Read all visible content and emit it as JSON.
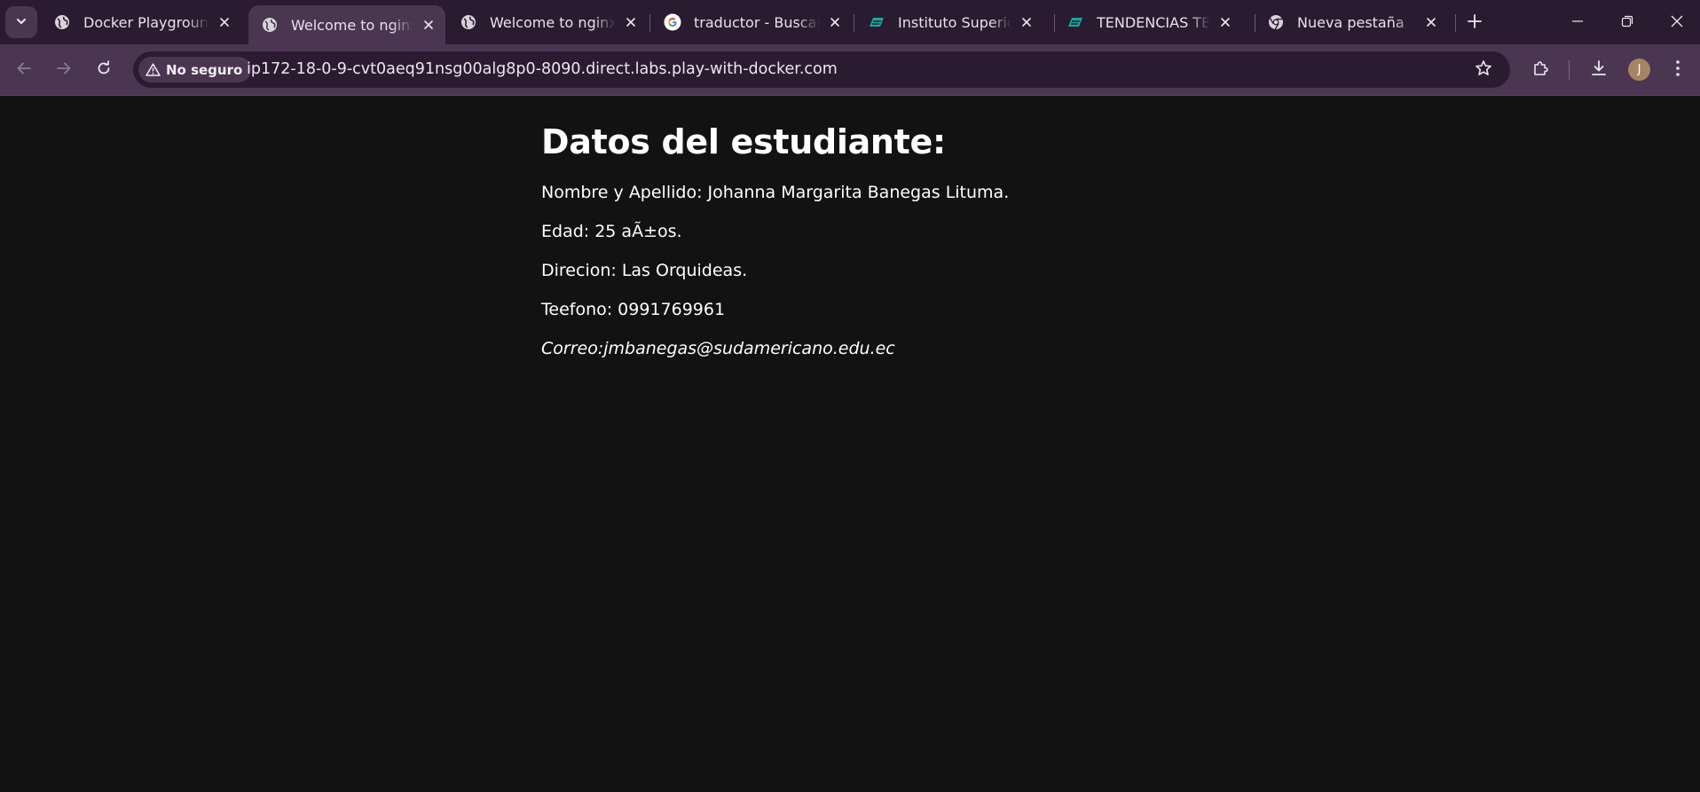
{
  "browser": {
    "tabs": [
      {
        "title": "Docker Playground",
        "favicon": "globe-icon",
        "active": false
      },
      {
        "title": "Welcome to nginx!",
        "favicon": "globe-icon",
        "active": true
      },
      {
        "title": "Welcome to nginx!",
        "favicon": "globe-icon",
        "active": false
      },
      {
        "title": "traductor - Buscar con Google",
        "favicon": "google-icon",
        "active": false
      },
      {
        "title": "Instituto Superior Tecnológico",
        "favicon": "institute-logo-icon",
        "active": false
      },
      {
        "title": "TENDENCIAS TECNOLÓGICAS",
        "favicon": "institute-logo-icon",
        "active": false
      },
      {
        "title": "Nueva pestaña",
        "favicon": "chrome-icon",
        "active": false
      }
    ],
    "security_chip": "No seguro",
    "url": "ip172-18-0-9-cvt0aeq91nsg00alg8p0-8090.direct.labs.play-with-docker.com",
    "avatar_initial": "J",
    "colors": {
      "tabstrip": "#2a1b30",
      "toolbar": "#4a3650",
      "omnibox": "#2b1b31",
      "page_background": "#121212",
      "page_text": "#ffffff"
    }
  },
  "page": {
    "heading": "Datos del estudiante:",
    "lines": {
      "name": "Nombre y Apellido: Johanna Margarita Banegas Lituma.",
      "age": "Edad: 25 aÃ±os.",
      "address": "Direcion: Las Orquideas.",
      "phone": "Teefono: 0991769961",
      "email": "Correo:jmbanegas@sudamericano.edu.ec"
    }
  }
}
